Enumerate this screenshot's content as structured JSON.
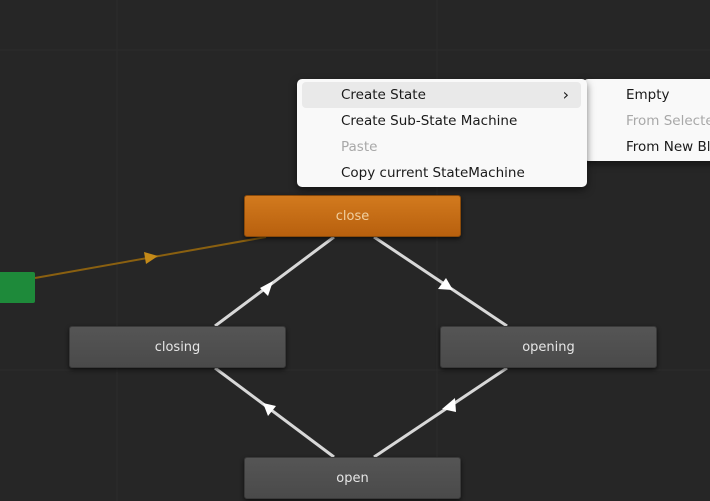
{
  "graph": {
    "states": [
      {
        "name": "close",
        "role": "default",
        "color": "#c46a16"
      },
      {
        "name": "closing",
        "role": "normal"
      },
      {
        "name": "opening",
        "role": "normal"
      },
      {
        "name": "open",
        "role": "normal"
      }
    ],
    "entry_color": "#1e8a3a",
    "transitions": [
      {
        "from": "entry",
        "to": "close"
      },
      {
        "from": "closing",
        "to": "close"
      },
      {
        "from": "close",
        "to": "opening"
      },
      {
        "from": "open",
        "to": "closing"
      },
      {
        "from": "opening",
        "to": "open"
      }
    ]
  },
  "context_menu": {
    "items": [
      {
        "label": "Create State",
        "enabled": true,
        "submenu": true,
        "chevron": "›"
      },
      {
        "label": "Create Sub-State Machine",
        "enabled": true
      },
      {
        "label": "Paste",
        "enabled": false
      },
      {
        "label": "Copy current StateMachine",
        "enabled": true
      }
    ]
  },
  "submenu": {
    "items": [
      {
        "label": "Empty",
        "enabled": true
      },
      {
        "label": "From Selecte",
        "enabled": false
      },
      {
        "label": "From New Bl",
        "enabled": true
      }
    ]
  }
}
